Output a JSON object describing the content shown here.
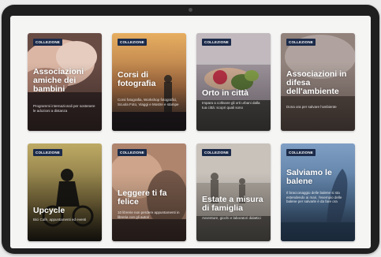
{
  "cards": [
    {
      "badge": "COLLEZIONE",
      "title": "Associazioni amiche dei bambini",
      "description": "Programmi internazionali per sostenere le adozioni a distanza",
      "image": "hands-holding-baby",
      "colors": [
        "#e9c3b2",
        "#8c6a5e",
        "#3b2a2a"
      ]
    },
    {
      "badge": "COLLEZIONE",
      "title": "Corsi di fotografia",
      "description": "Corsi fotografia, Workshop fotografici, Scuola Foto, Viaggi e Mostre e stampe",
      "image": "photographer-sunset",
      "colors": [
        "#f0b060",
        "#a06840",
        "#2c2a33"
      ]
    },
    {
      "badge": "COLLEZIONE",
      "title": "Orto in città",
      "description": "Impara a coltivare gli orti urbani dalla tua città: scopri quali sono",
      "image": "hands-with-vegetables",
      "colors": [
        "#c7bcc0",
        "#7a6f7a",
        "#3e4a2c"
      ]
    },
    {
      "badge": "COLLEZIONE",
      "title": "Associazioni in difesa dell'ambiente",
      "description": "Dona ora per salvare l'ambiente",
      "image": "environment",
      "colors": [
        "#b5a7a2",
        "#85726c",
        "#4b403b"
      ]
    },
    {
      "badge": "COLLEZIONE",
      "title": "Upcycle",
      "description": "Bici Cafè, appuntamenti ed eventi",
      "image": "cyclist-sunset",
      "colors": [
        "#b8a25c",
        "#5a5030",
        "#201d15"
      ]
    },
    {
      "badge": "COLLEZIONE",
      "title": "Leggere ti fa felice",
      "description": "10 librerie non perdere appuntamenti in libreria con gli autori",
      "image": "person-reading",
      "colors": [
        "#d6a88a",
        "#8a6a58",
        "#3c2e28"
      ]
    },
    {
      "badge": "COLLEZIONE",
      "title": "Estate a misura di famiglia",
      "description": "Avventure, giochi e laboratori didattici",
      "image": "family-beach",
      "colors": [
        "#c9c0b6",
        "#8f8a84",
        "#4f4c48"
      ]
    },
    {
      "badge": "COLLEZIONE",
      "title": "Salviamo le balene",
      "description": "Il bracconaggio delle balene si sta estendendo ai mari, l'esempio delle balene per salvarle è da fare ora",
      "image": "whale-breaching",
      "colors": [
        "#7fa0c8",
        "#4c6f9c",
        "#27405f"
      ]
    }
  ]
}
